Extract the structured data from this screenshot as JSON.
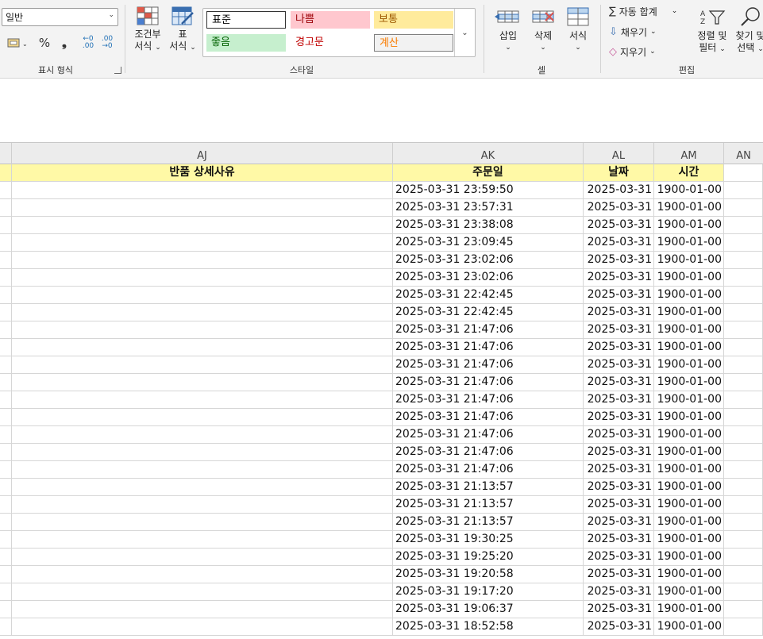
{
  "ribbon": {
    "number_format": {
      "value": "일반",
      "group_label": "표시 형식",
      "currency_icon": "accounting-format-icon",
      "percent_label": "%",
      "comma_label": "❟",
      "increase_decimal_label": "←0 .00",
      "decrease_decimal_label": ".00 →0"
    },
    "styles": {
      "conditional_label_1": "조건부",
      "conditional_label_2": "서식",
      "table_label_1": "표",
      "table_label_2": "서식",
      "group_label": "스타일",
      "gallery": [
        {
          "label": "표준",
          "bg": "#ffffff",
          "color": "#000000",
          "border": "#333333"
        },
        {
          "label": "나쁨",
          "bg": "#ffc7ce",
          "color": "#9c0006",
          "border": ""
        },
        {
          "label": "보통",
          "bg": "#ffeb9c",
          "color": "#9c5700",
          "border": ""
        },
        {
          "label": "좋음",
          "bg": "#c6efce",
          "color": "#006100",
          "border": ""
        },
        {
          "label": "경고문",
          "bg": "#ffffff",
          "color": "#c00000",
          "border": ""
        },
        {
          "label": "계산",
          "bg": "#f2f2f2",
          "color": "#fa7d00",
          "border": "#7f7f7f"
        }
      ]
    },
    "cells": {
      "insert_label": "삽입",
      "delete_label": "삭제",
      "format_label": "서식",
      "group_label": "셀"
    },
    "editing": {
      "autosum_label": "자동 합계",
      "fill_label": "채우기",
      "clear_label": "지우기",
      "sort_label_1": "정렬 및",
      "sort_label_2": "필터",
      "find_label_1": "찾기 및",
      "find_label_2": "선택",
      "group_label": "편집"
    }
  },
  "columns": [
    {
      "id": "aj",
      "letter": "AJ"
    },
    {
      "id": "ak",
      "letter": "AK"
    },
    {
      "id": "al",
      "letter": "AL"
    },
    {
      "id": "am",
      "letter": "AM"
    },
    {
      "id": "an",
      "letter": "AN"
    }
  ],
  "header_row": {
    "aj": "반품 상세사유",
    "ak": "주문일",
    "al": "날짜",
    "am": "시간"
  },
  "header_fill_color": "#fff9a6",
  "rows": [
    {
      "ak": "2025-03-31 23:59:50",
      "al": "2025-03-31",
      "am": "1900-01-00"
    },
    {
      "ak": "2025-03-31 23:57:31",
      "al": "2025-03-31",
      "am": "1900-01-00"
    },
    {
      "ak": "2025-03-31 23:38:08",
      "al": "2025-03-31",
      "am": "1900-01-00"
    },
    {
      "ak": "2025-03-31 23:09:45",
      "al": "2025-03-31",
      "am": "1900-01-00"
    },
    {
      "ak": "2025-03-31 23:02:06",
      "al": "2025-03-31",
      "am": "1900-01-00"
    },
    {
      "ak": "2025-03-31 23:02:06",
      "al": "2025-03-31",
      "am": "1900-01-00"
    },
    {
      "ak": "2025-03-31 22:42:45",
      "al": "2025-03-31",
      "am": "1900-01-00"
    },
    {
      "ak": "2025-03-31 22:42:45",
      "al": "2025-03-31",
      "am": "1900-01-00"
    },
    {
      "ak": "2025-03-31 21:47:06",
      "al": "2025-03-31",
      "am": "1900-01-00"
    },
    {
      "ak": "2025-03-31 21:47:06",
      "al": "2025-03-31",
      "am": "1900-01-00"
    },
    {
      "ak": "2025-03-31 21:47:06",
      "al": "2025-03-31",
      "am": "1900-01-00"
    },
    {
      "ak": "2025-03-31 21:47:06",
      "al": "2025-03-31",
      "am": "1900-01-00"
    },
    {
      "ak": "2025-03-31 21:47:06",
      "al": "2025-03-31",
      "am": "1900-01-00"
    },
    {
      "ak": "2025-03-31 21:47:06",
      "al": "2025-03-31",
      "am": "1900-01-00"
    },
    {
      "ak": "2025-03-31 21:47:06",
      "al": "2025-03-31",
      "am": "1900-01-00"
    },
    {
      "ak": "2025-03-31 21:47:06",
      "al": "2025-03-31",
      "am": "1900-01-00"
    },
    {
      "ak": "2025-03-31 21:47:06",
      "al": "2025-03-31",
      "am": "1900-01-00"
    },
    {
      "ak": "2025-03-31 21:13:57",
      "al": "2025-03-31",
      "am": "1900-01-00"
    },
    {
      "ak": "2025-03-31 21:13:57",
      "al": "2025-03-31",
      "am": "1900-01-00"
    },
    {
      "ak": "2025-03-31 21:13:57",
      "al": "2025-03-31",
      "am": "1900-01-00"
    },
    {
      "ak": "2025-03-31 19:30:25",
      "al": "2025-03-31",
      "am": "1900-01-00"
    },
    {
      "ak": "2025-03-31 19:25:20",
      "al": "2025-03-31",
      "am": "1900-01-00"
    },
    {
      "ak": "2025-03-31 19:20:58",
      "al": "2025-03-31",
      "am": "1900-01-00"
    },
    {
      "ak": "2025-03-31 19:17:20",
      "al": "2025-03-31",
      "am": "1900-01-00"
    },
    {
      "ak": "2025-03-31 19:06:37",
      "al": "2025-03-31",
      "am": "1900-01-00"
    },
    {
      "ak": "2025-03-31 18:52:58",
      "al": "2025-03-31",
      "am": "1900-01-00"
    }
  ]
}
